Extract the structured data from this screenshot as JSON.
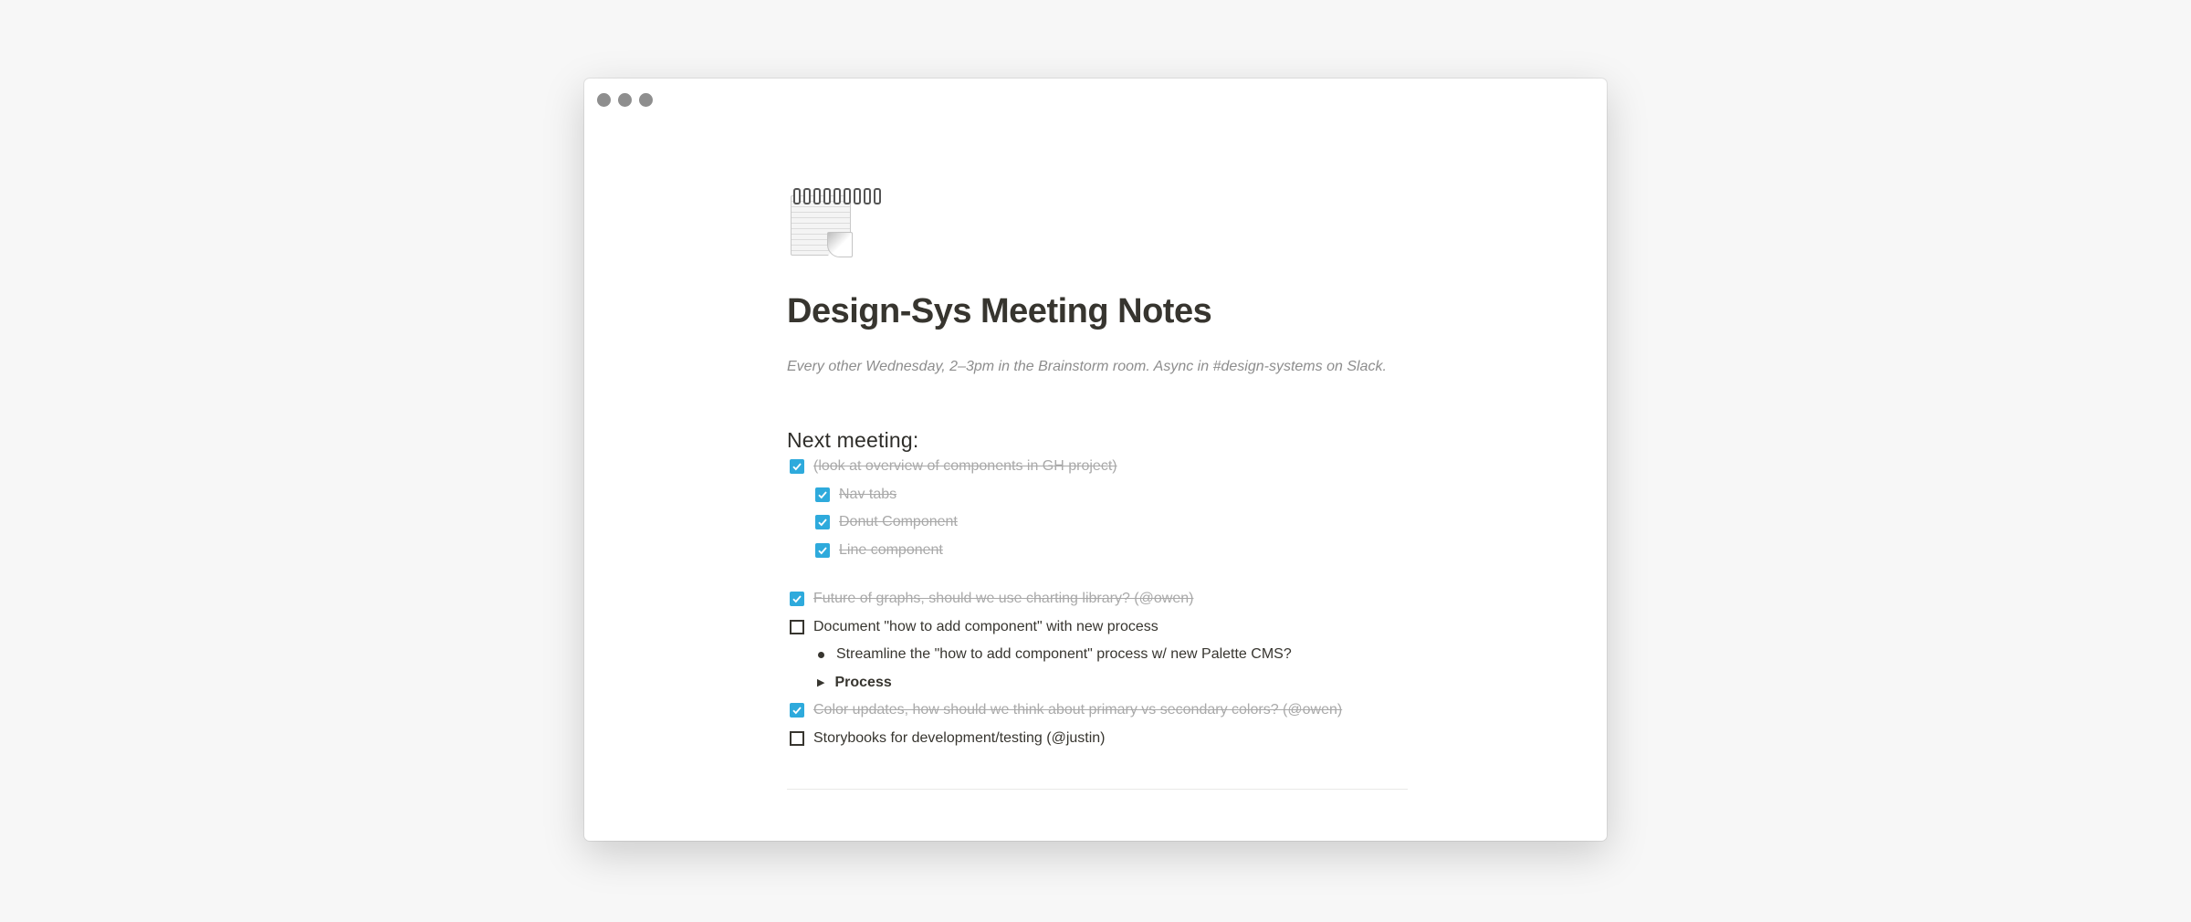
{
  "page": {
    "icon": "spiral-notepad-icon",
    "title": "Design-Sys Meeting Notes",
    "subtitle": "Every other Wednesday, 2–3pm in the Brainstorm room. Async in #design-systems on Slack.",
    "heading": "Next meeting:"
  },
  "colors": {
    "accent": "#2eaadc",
    "text": "#37352f",
    "muted": "#a9a9a9",
    "traffic_dot": "#8e8e8e"
  },
  "items": [
    {
      "text": "(look at overview of components in GH project)",
      "checked": true
    },
    {
      "text": "Nav tabs",
      "checked": true
    },
    {
      "text": "Donut Component",
      "checked": true
    },
    {
      "text": "Line component",
      "checked": true
    },
    {
      "text": "Future of graphs, should we use charting library? (@owen)",
      "checked": true
    },
    {
      "text": "Document \"how to add component\" with new process",
      "checked": false
    },
    {
      "text": "Streamline the \"how to add component\" process w/ new Palette CMS?"
    },
    {
      "text": "Process"
    },
    {
      "text": "Color updates, how should we think about primary vs secondary colors? (@owen)",
      "checked": true
    },
    {
      "text": "Storybooks for development/testing (@justin)",
      "checked": false
    }
  ]
}
